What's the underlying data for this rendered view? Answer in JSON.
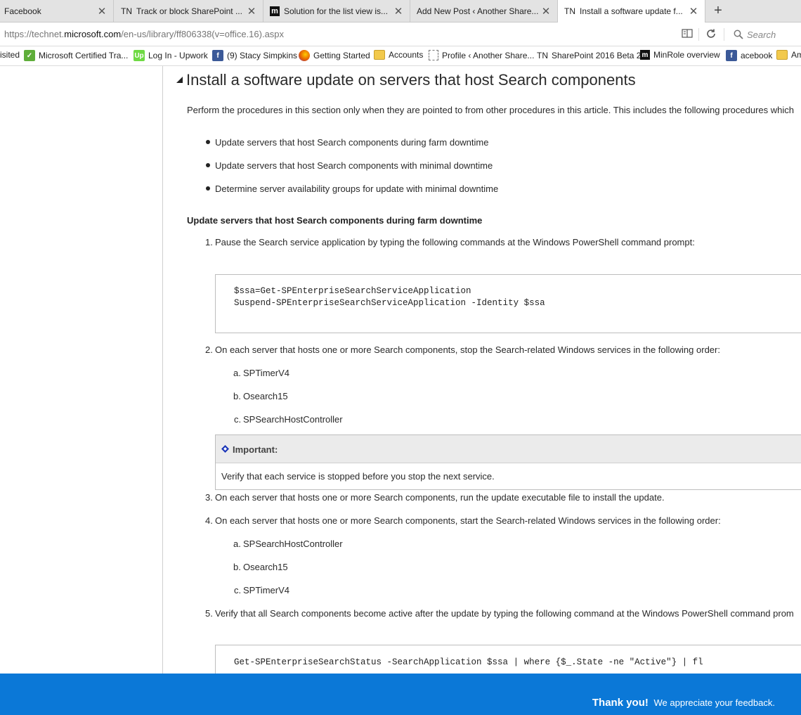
{
  "browser": {
    "tabs": [
      {
        "prefix": "",
        "label": "Facebook"
      },
      {
        "prefix": "TN",
        "label": "Track or block SharePoint ..."
      },
      {
        "prefix": "m",
        "label": "Solution for the list view is..."
      },
      {
        "prefix": "",
        "label": "Add New Post ‹ Another Share..."
      },
      {
        "prefix": "TN",
        "label": "Install a software update f..."
      }
    ],
    "active_tab_index": 4,
    "url_prefix": "https://technet.",
    "url_domain": "microsoft.com",
    "url_suffix": "/en-us/library/ff806338(v=office.16).aspx",
    "search_placeholder": "Search",
    "bookmarks": [
      {
        "icon": "none",
        "label": "isited"
      },
      {
        "icon": "certificate-icon",
        "label": "Microsoft Certified Tra..."
      },
      {
        "icon": "upwork-icon",
        "label": "Log In - Upwork"
      },
      {
        "icon": "facebook-icon",
        "label": "(9) Stacy Simpkins"
      },
      {
        "icon": "firefox-icon",
        "label": "Getting Started"
      },
      {
        "icon": "folder-icon",
        "label": "Accounts"
      },
      {
        "icon": "page-icon",
        "label": "Profile ‹ Another Share..."
      },
      {
        "icon": "tn-icon",
        "label": "SharePoint 2016 Beta 2"
      },
      {
        "icon": "m-icon",
        "label": "MinRole overview"
      },
      {
        "icon": "facebook-icon",
        "label": "acebook"
      },
      {
        "icon": "folder-icon",
        "label": "Am"
      }
    ]
  },
  "article": {
    "section_title": "Install a software update on servers that host Search components",
    "intro": "Perform the procedures in this section only when they are pointed to from other procedures in this article. This includes the following procedures which",
    "bullets": [
      "Update servers that host Search components during farm downtime",
      "Update servers that host Search components with minimal downtime",
      "Determine server availability groups for update with minimal downtime"
    ],
    "subsection_title": "Update servers that host Search components during farm downtime",
    "steps": {
      "s1": {
        "num": "1.",
        "text": "Pause the Search service application by typing the following commands at the Windows PowerShell command prompt:"
      },
      "s2": {
        "num": "2.",
        "text": "On each server that hosts one or more Search components, stop the Search-related Windows services in the following order:"
      },
      "s3": {
        "num": "3.",
        "text": "On each server that hosts one or more Search components, run the update executable file to install the update."
      },
      "s4": {
        "num": "4.",
        "text": "On each server that hosts one or more Search components, start the Search-related Windows services in the following order:"
      },
      "s5": {
        "num": "5.",
        "text": "Verify that all Search components become active after the update by typing the following command at the Windows PowerShell command prom"
      }
    },
    "code1_line1": "$ssa=Get-SPEnterpriseSearchServiceApplication",
    "code1_line2": "Suspend-SPEnterpriseSearchServiceApplication -Identity $ssa",
    "stop_order": [
      {
        "letter": "a.",
        "text": "SPTimerV4"
      },
      {
        "letter": "b.",
        "text": "Osearch15"
      },
      {
        "letter": "c.",
        "text": "SPSearchHostController"
      }
    ],
    "important_title": "Important:",
    "important_body": "Verify that each service is stopped before you stop the next service.",
    "start_order": [
      {
        "letter": "a.",
        "text": "SPSearchHostController"
      },
      {
        "letter": "b.",
        "text": "Osearch15"
      },
      {
        "letter": "c.",
        "text": "SPTimerV4"
      }
    ],
    "code2": "Get-SPEnterpriseSearchStatus -SearchApplication $ssa | where {$_.State -ne \"Active\"} | fl"
  },
  "feedback": {
    "thanks": "Thank you!",
    "message": "We appreciate your feedback."
  },
  "colors": {
    "banner": "#0b78d7",
    "alert_header": "#ebebeb"
  }
}
